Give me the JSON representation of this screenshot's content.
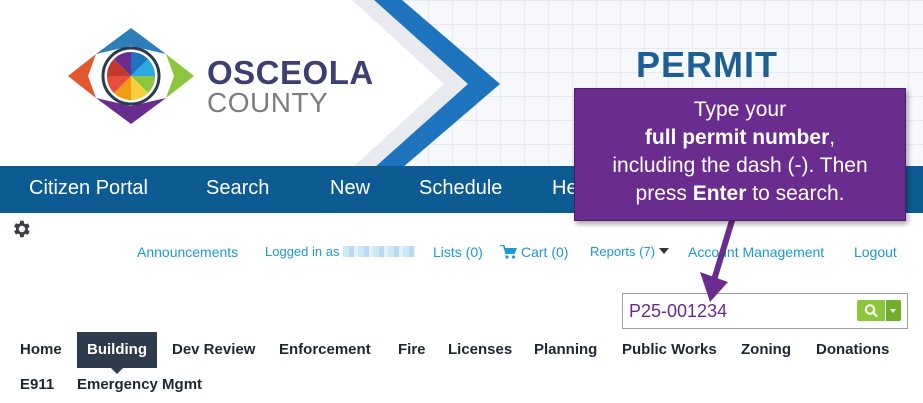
{
  "banner": {
    "logo_line1": "OSCEOLA",
    "logo_line2": "COUNTY",
    "title": "PERMIT"
  },
  "nav": {
    "items": [
      "Citizen Portal",
      "Search",
      "New",
      "Schedule",
      "He"
    ]
  },
  "toplinks": {
    "announcements": "Announcements",
    "logged_in": "Logged in as",
    "lists": "Lists (0)",
    "cart": "Cart (0)",
    "reports": "Reports (7)",
    "account": "Account Management",
    "logout": "Logout"
  },
  "search": {
    "value": "P25-001234"
  },
  "tabs": {
    "items": [
      "Home",
      "Building",
      "Dev Review",
      "Enforcement",
      "Fire",
      "Licenses",
      "Planning",
      "Public Works",
      "Zoning",
      "Donations",
      "E911",
      "Emergency Mgmt"
    ],
    "active": "Building"
  },
  "callout": {
    "line1": "Type your",
    "bold1": "full permit number",
    "line2_tail": ",",
    "line3": "including the dash (-). Then",
    "press": "press",
    "enter": "Enter",
    "line4_tail": "to search."
  },
  "colors": {
    "nav_bg": "#0c5b93",
    "link": "#1a9ad6",
    "callout_bg": "#6a2c8f",
    "search_button": "#8cc63f",
    "active_tab": "#2d3b4d"
  },
  "icons": [
    "gear-icon",
    "cart-icon",
    "search-icon",
    "chevron-down-icon"
  ]
}
